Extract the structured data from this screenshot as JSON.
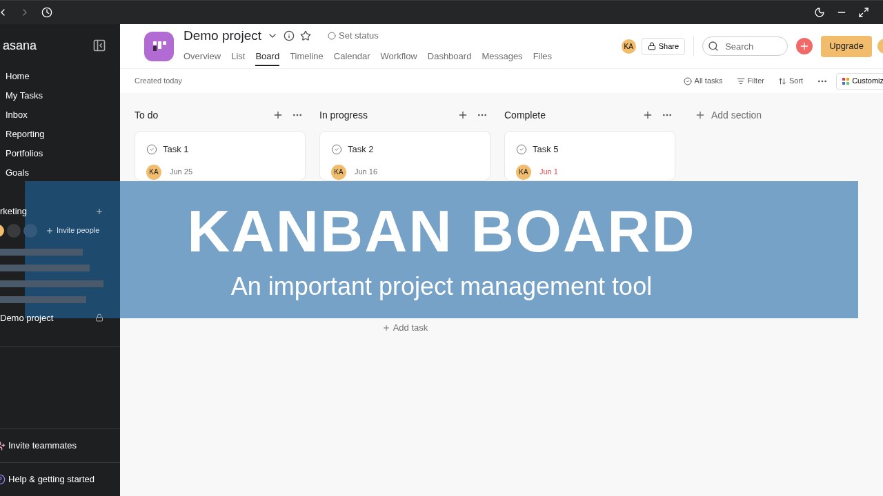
{
  "sidebar": {
    "logo": "asana",
    "nav": [
      {
        "label": "Home"
      },
      {
        "label": "My Tasks"
      },
      {
        "label": "Inbox"
      },
      {
        "label": "Reporting"
      },
      {
        "label": "Portfolios"
      },
      {
        "label": "Goals"
      }
    ],
    "team": {
      "name": "rketing",
      "invite": "Invite people"
    },
    "projects": [
      {
        "name": "Demo project",
        "locked": true
      }
    ],
    "footer": [
      {
        "kind": "invite",
        "label": "Invite teammates"
      },
      {
        "kind": "help",
        "label": "Help & getting started"
      }
    ]
  },
  "header": {
    "title": "Demo project",
    "set_status": "Set status",
    "tabs": [
      {
        "label": "Overview",
        "selected": false
      },
      {
        "label": "List",
        "selected": false
      },
      {
        "label": "Board",
        "selected": true
      },
      {
        "label": "Timeline",
        "selected": false
      },
      {
        "label": "Calendar",
        "selected": false
      },
      {
        "label": "Workflow",
        "selected": false
      },
      {
        "label": "Dashboard",
        "selected": false
      },
      {
        "label": "Messages",
        "selected": false
      },
      {
        "label": "Files",
        "selected": false
      }
    ],
    "avatar": "KA",
    "share": "Share",
    "search_placeholder": "Search",
    "upgrade": "Upgrade"
  },
  "toolbar": {
    "created": "Created today",
    "actions": [
      {
        "kind": "tasks",
        "label": "All tasks"
      },
      {
        "kind": "filter",
        "label": "Filter"
      },
      {
        "kind": "sort",
        "label": "Sort"
      }
    ],
    "customize": "Customiz"
  },
  "columns": [
    {
      "name": "To do",
      "tasks": [
        {
          "title": "Task 1",
          "avatar": "KA",
          "due": "Jun 25",
          "overdue": false
        }
      ]
    },
    {
      "name": "In progress",
      "tasks": [
        {
          "title": "Task 2",
          "avatar": "KA",
          "due": "Jun 16",
          "overdue": false
        }
      ],
      "add_task": "Add task"
    },
    {
      "name": "Complete",
      "tasks": [
        {
          "title": "Task 5",
          "avatar": "KA",
          "due": "Jun 1",
          "overdue": true
        }
      ]
    }
  ],
  "add_section": "Add section",
  "banner": {
    "title": "KANBAN BOARD",
    "subtitle": "An important project management tool"
  }
}
